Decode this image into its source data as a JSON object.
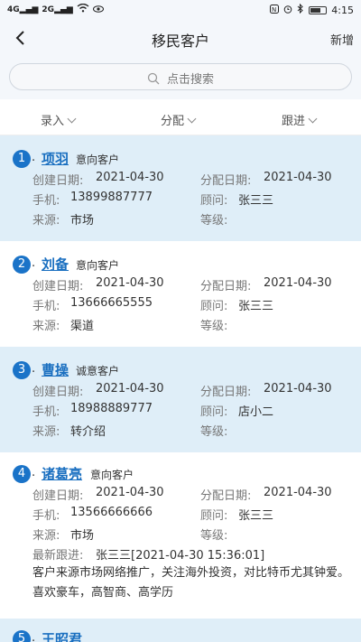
{
  "status_bar": {
    "signal1": "4G",
    "signal2": "2G",
    "time": "4:15"
  },
  "header": {
    "title": "移民客户",
    "add_label": "新增"
  },
  "search": {
    "placeholder": "点击搜索"
  },
  "filters": [
    {
      "label": "录入"
    },
    {
      "label": "分配"
    },
    {
      "label": "跟进"
    }
  ],
  "customers": [
    {
      "index": "1",
      "name": "项羽",
      "type": "意向客户",
      "created_label": "创建日期:",
      "created": "2021-04-30",
      "assigned_label": "分配日期:",
      "assigned": "2021-04-30",
      "phone_label": "手机:",
      "phone": "13899887777",
      "advisor_label": "顾问:",
      "advisor": "张三三",
      "source_label": "来源:",
      "source": "市场",
      "level_label": "等级:",
      "level": ""
    },
    {
      "index": "2",
      "name": "刘备",
      "type": "意向客户",
      "created_label": "创建日期:",
      "created": "2021-04-30",
      "assigned_label": "分配日期:",
      "assigned": "2021-04-30",
      "phone_label": "手机:",
      "phone": "13666665555",
      "advisor_label": "顾问:",
      "advisor": "张三三",
      "source_label": "来源:",
      "source": "渠道",
      "level_label": "等级:",
      "level": ""
    },
    {
      "index": "3",
      "name": "曹操",
      "type": "诚意客户",
      "created_label": "创建日期:",
      "created": "2021-04-30",
      "assigned_label": "分配日期:",
      "assigned": "2021-04-30",
      "phone_label": "手机:",
      "phone": "18988889777",
      "advisor_label": "顾问:",
      "advisor": "店小二",
      "source_label": "来源:",
      "source": "转介绍",
      "level_label": "等级:",
      "level": ""
    },
    {
      "index": "4",
      "name": "诸葛亮",
      "type": "意向客户",
      "created_label": "创建日期:",
      "created": "2021-04-30",
      "assigned_label": "分配日期:",
      "assigned": "2021-04-30",
      "phone_label": "手机:",
      "phone": "13566666666",
      "advisor_label": "顾问:",
      "advisor": "张三三",
      "source_label": "来源:",
      "source": "市场",
      "level_label": "等级:",
      "level": "",
      "followup_label": "最新跟进:",
      "followup": "张三三[2021-04-30 15:36:01]",
      "note": "客户来源市场网络推广，关注海外投资，对比特币尤其钟爱。喜欢豪车，高智商、高学历"
    },
    {
      "index": "5",
      "name": "王昭君"
    }
  ]
}
